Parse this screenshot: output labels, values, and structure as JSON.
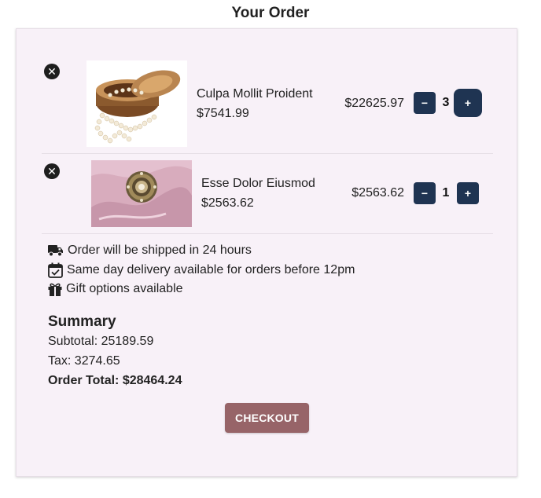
{
  "page": {
    "title": "Your Order"
  },
  "items": [
    {
      "name": "Culpa Mollit Proident",
      "unit_price": "$7541.99",
      "line_total": "$22625.97",
      "quantity": "3",
      "remove_icon": "x-circle-icon",
      "image": "jewelry-box-pearls"
    },
    {
      "name": "Esse Dolor Eiusmod",
      "unit_price": "$2563.62",
      "line_total": "$2563.62",
      "quantity": "1",
      "remove_icon": "x-circle-icon",
      "image": "brooch-on-pink-silk"
    }
  ],
  "qty_controls": {
    "decrement": "−",
    "increment": "+"
  },
  "info": {
    "shipping": {
      "icon": "truck-icon",
      "text": "Order will be shipped in 24 hours"
    },
    "delivery": {
      "icon": "calendar-check-icon",
      "text": "Same day delivery available for orders before 12pm"
    },
    "gift": {
      "icon": "gift-icon",
      "text": "Gift options available"
    }
  },
  "summary": {
    "title": "Summary",
    "subtotal_label": "Subtotal: ",
    "subtotal": "25189.59",
    "tax_label": "Tax: ",
    "tax": "3274.65",
    "total_label": "Order Total: ",
    "total": "$28464.24"
  },
  "checkout_label": "CHECKOUT",
  "colors": {
    "card_bg": "#f8f1f8",
    "qty_button": "#1f3452",
    "checkout": "#976468"
  }
}
